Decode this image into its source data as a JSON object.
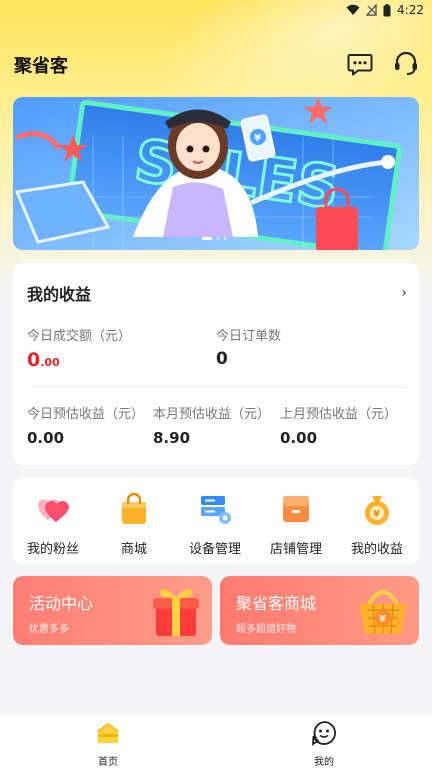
{
  "status_bar": {
    "time": "4:22"
  },
  "header": {
    "title": "聚省客"
  },
  "earnings": {
    "title": "我的收益",
    "today_volume": {
      "label": "今日成交额（元）",
      "value_int": "0",
      "value_dec": ".00"
    },
    "today_orders": {
      "label": "今日订单数",
      "value": "0"
    },
    "today_estimated": {
      "label": "今日预估收益（元）",
      "value": "0.00"
    },
    "month_estimated": {
      "label": "本月预估收益（元）",
      "value": "8.90"
    },
    "last_month_estimated": {
      "label": "上月预估收益（元）",
      "value": "0.00"
    }
  },
  "menu": [
    {
      "label": "我的粉丝",
      "icon": "heart-icon"
    },
    {
      "label": "商城",
      "icon": "shopping-bag-icon"
    },
    {
      "label": "设备管理",
      "icon": "device-icon"
    },
    {
      "label": "店铺管理",
      "icon": "store-icon"
    },
    {
      "label": "我的收益",
      "icon": "money-bag-icon"
    }
  ],
  "promos": [
    {
      "title": "活动中心",
      "subtitle": "优惠多多",
      "icon": "gift-box-icon"
    },
    {
      "title": "聚省客商城",
      "subtitle": "超多超值好物",
      "icon": "shopping-basket-icon"
    }
  ],
  "bottom_nav": [
    {
      "label": "首页",
      "icon": "home-icon",
      "active": true
    },
    {
      "label": "我的",
      "icon": "profile-icon",
      "active": false
    }
  ],
  "colors": {
    "accent_red": "#e2232a",
    "brand_yellow": "#ffe45c",
    "promo_red": "#ff7d74"
  }
}
